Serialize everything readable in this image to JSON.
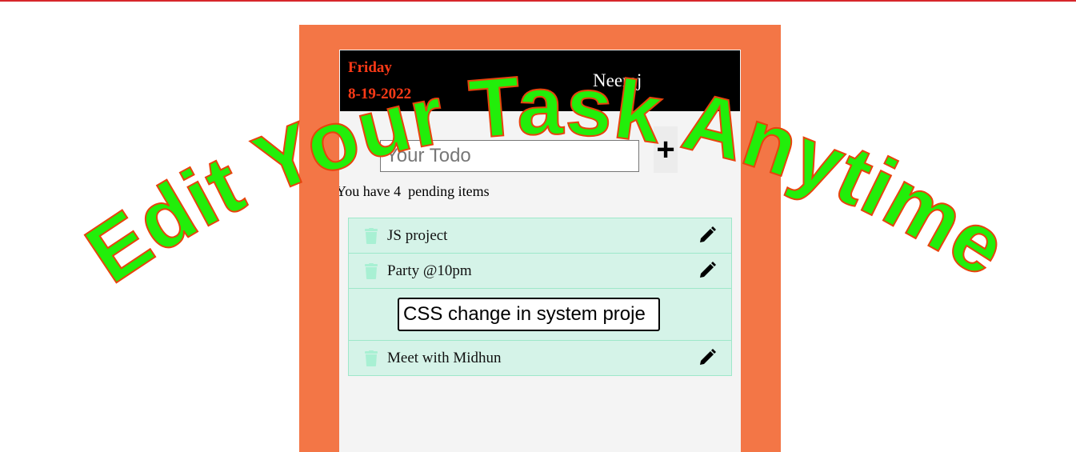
{
  "header": {
    "day": "Friday",
    "date": "8-19-2022",
    "user": "Neeraj"
  },
  "composer": {
    "placeholder": "Your Todo",
    "add_label": "+"
  },
  "status": {
    "pending_text": "You have 4  pending items"
  },
  "todos": [
    {
      "label": "JS project",
      "editing": false
    },
    {
      "label": "Party @10pm",
      "editing": false
    },
    {
      "label": "",
      "editing": true,
      "edit_value": "CSS change in system proje"
    },
    {
      "label": "Meet with Midhun",
      "editing": false
    }
  ],
  "overlay": {
    "text": "Edit Your Task Anytime",
    "fill_color": "#22ee0a",
    "stroke_color": "#e8430c"
  },
  "colors": {
    "frame": "#f37646",
    "header_bg": "#000000",
    "date_color": "#ff3a17",
    "item_bg": "#d5f3e8",
    "item_border": "#9ee8ca",
    "trash_color": "#a8f0d3"
  },
  "icons": {
    "delete": "trash-icon",
    "edit": "pencil-icon",
    "add": "plus-icon"
  }
}
